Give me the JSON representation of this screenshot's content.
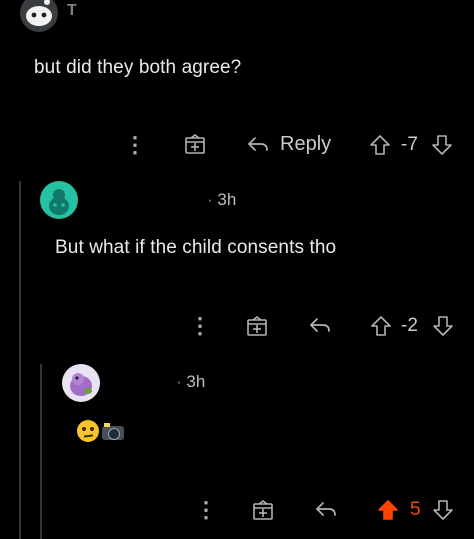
{
  "comments": [
    {
      "username": "T",
      "text": "but did they both agree?",
      "reply_label": "Reply",
      "score": "-7",
      "icons": [
        "more-icon",
        "award-icon",
        "reply-icon",
        "upvote-icon",
        "downvote-icon"
      ]
    },
    {
      "time": "3h",
      "text": "But what if the child consents tho",
      "score": "-2",
      "icons": [
        "more-icon",
        "award-icon",
        "reply-icon",
        "upvote-icon",
        "downvote-icon"
      ]
    },
    {
      "time": "3h",
      "emojis": [
        "🫤",
        "📸"
      ],
      "score": "5",
      "upvoted": true,
      "icons": [
        "more-icon",
        "award-icon",
        "reply-icon",
        "upvote-filled-icon",
        "downvote-icon"
      ]
    }
  ],
  "colors": {
    "background": "#000000",
    "text": "#d7dadc",
    "upvote_active": "#ff4500",
    "avatar_teal": "#24c2a3",
    "avatar_lilac": "#e9e2f3"
  }
}
